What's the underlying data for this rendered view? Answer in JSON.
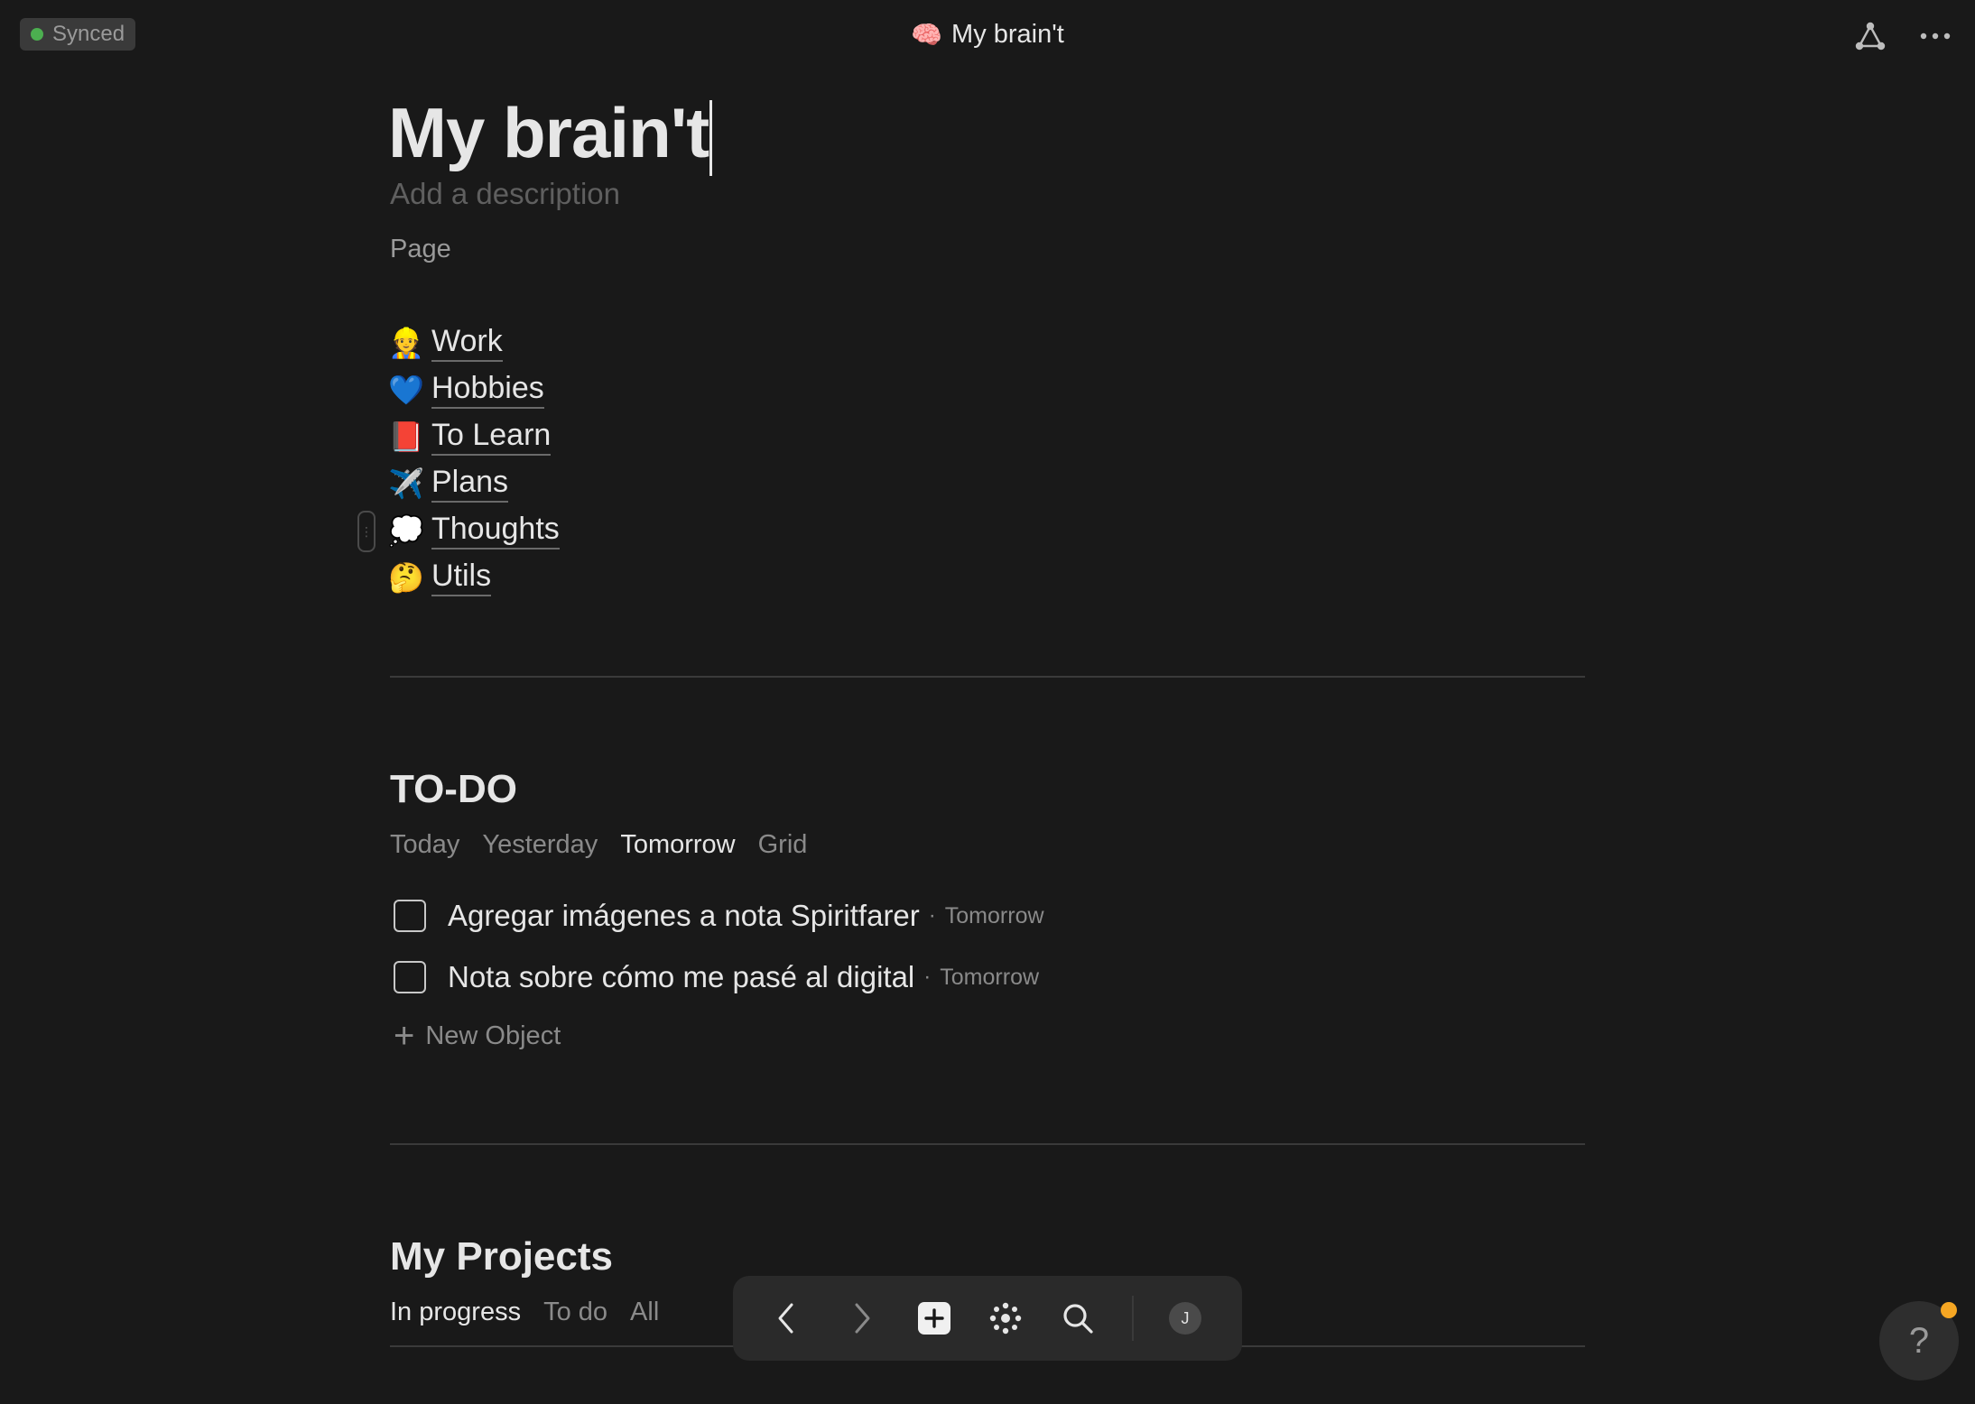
{
  "topbar": {
    "sync_status": "Synced",
    "title_emoji": "🧠",
    "title": "My brain't",
    "graph_icon": "graph-icon",
    "more_icon": "more-icon"
  },
  "page": {
    "title": "My brain't",
    "description_placeholder": "Add a description",
    "type": "Page"
  },
  "links": [
    {
      "emoji": "👷",
      "label": "Work"
    },
    {
      "emoji": "💙",
      "label": "Hobbies"
    },
    {
      "emoji": "📕",
      "label": "To Learn"
    },
    {
      "emoji": "✈️",
      "label": "Plans"
    },
    {
      "emoji": "💭",
      "label": "Thoughts"
    },
    {
      "emoji": "🤔",
      "label": "Utils"
    }
  ],
  "todo": {
    "heading": "TO-DO",
    "tabs": [
      "Today",
      "Yesterday",
      "Tomorrow",
      "Grid"
    ],
    "active_tab": "Tomorrow",
    "tasks": [
      {
        "title": "Agregar imágenes a nota Spiritfarer",
        "date": "Tomorrow",
        "checked": false
      },
      {
        "title": "Nota sobre cómo me pasé al digital",
        "date": "Tomorrow",
        "checked": false
      }
    ],
    "new_object_label": "New Object"
  },
  "projects": {
    "heading": "My Projects",
    "tabs": [
      "In progress",
      "To do",
      "All"
    ],
    "active_tab": "In progress"
  },
  "toolbar": {
    "avatar_initial": "J"
  },
  "help": {
    "label": "?"
  },
  "colors": {
    "background": "#191919",
    "synced_dot": "#4caf50",
    "notification_dot": "#f5a623"
  }
}
